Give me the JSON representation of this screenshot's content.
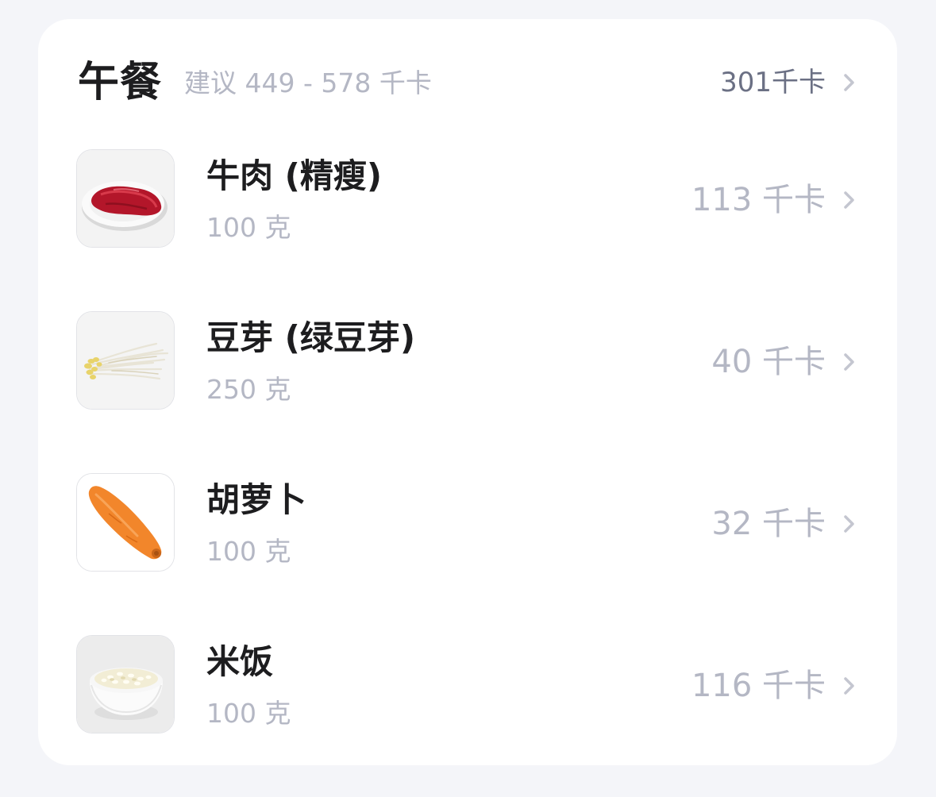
{
  "meal": {
    "title": "午餐",
    "suggestion": "建议 449 - 578 千卡",
    "total": "301千卡"
  },
  "items": [
    {
      "name": "牛肉 (精瘦)",
      "amount": "100 克",
      "kcal": "113 千卡",
      "image": "beef-image"
    },
    {
      "name": "豆芽 (绿豆芽)",
      "amount": "250 克",
      "kcal": "40 千卡",
      "image": "bean-sprouts-image"
    },
    {
      "name": "胡萝卜",
      "amount": "100 克",
      "kcal": "32 千卡",
      "image": "carrot-image"
    },
    {
      "name": "米饭",
      "amount": "100 克",
      "kcal": "116 千卡",
      "image": "rice-image"
    }
  ],
  "colors": {
    "background": "#f4f5f9",
    "card": "#ffffff",
    "title_text": "#1d1d1f",
    "secondary_text": "#b4b7c4",
    "total_text": "#6b7084"
  },
  "icons": {
    "chevron": "chevron-right-icon"
  }
}
